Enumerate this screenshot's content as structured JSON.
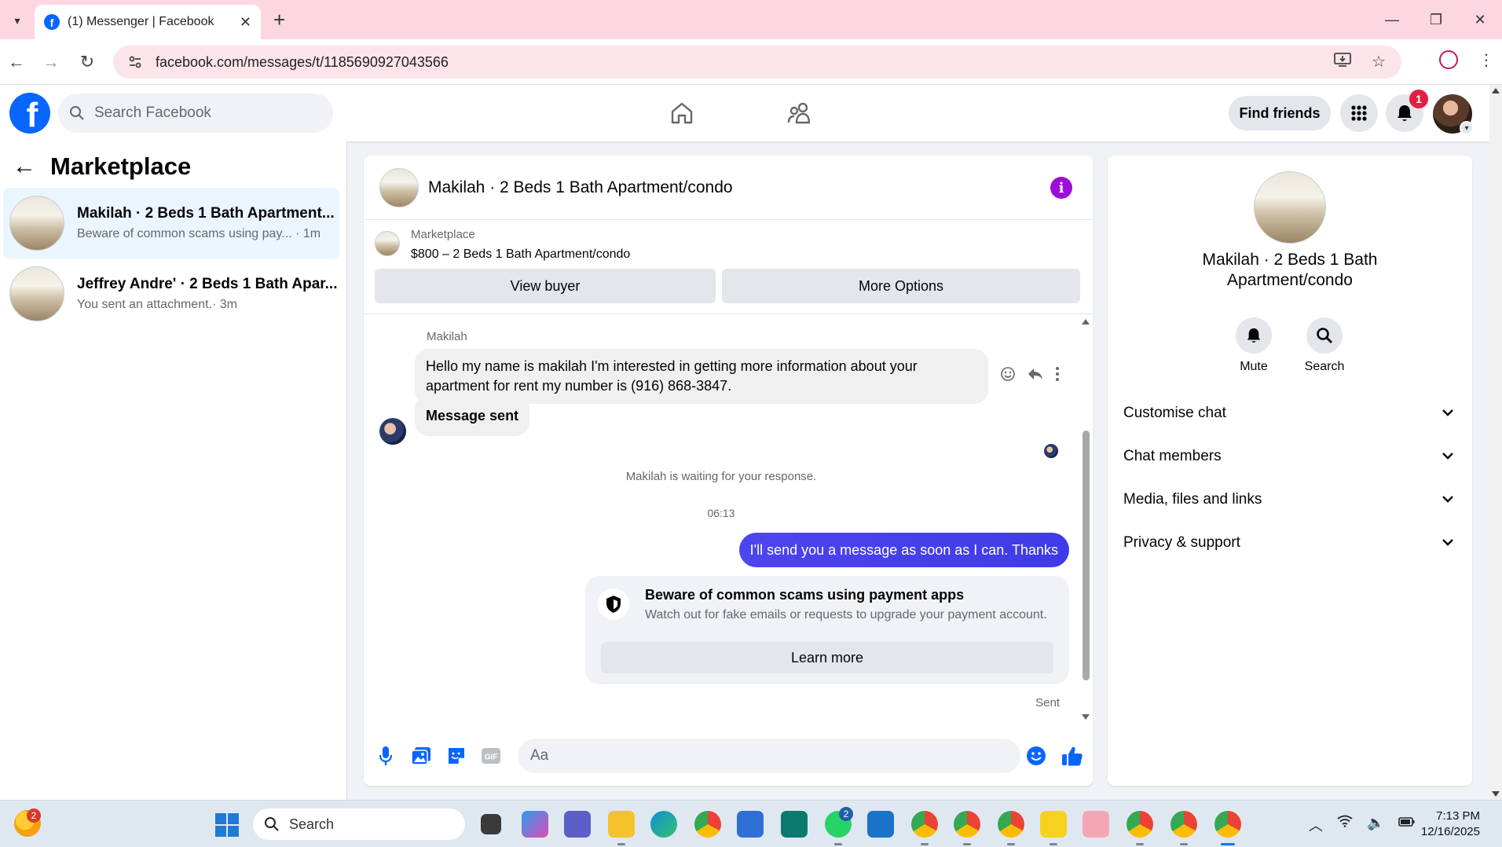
{
  "browser": {
    "tab_title": "(1) Messenger | Facebook",
    "url": "facebook.com/messages/t/1185690927043566"
  },
  "header": {
    "search_placeholder": "Search Facebook",
    "find_friends": "Find friends",
    "notification_count": "1"
  },
  "sidebar": {
    "title": "Marketplace",
    "conversations": [
      {
        "name": "Makilah · 2 Beds 1 Bath Apartment...",
        "preview": "Beware of common scams using pay...",
        "time": "· 1m",
        "active": true
      },
      {
        "name": "Jeffrey Andre' · 2 Beds 1 Bath Apar...",
        "preview": "You sent an attachment.",
        "time": "· 3m",
        "active": false
      }
    ]
  },
  "chat": {
    "title": "Makilah · 2 Beds 1 Bath Apartment/condo",
    "marketplace_label": "Marketplace",
    "listing": "$800 – 2 Beds 1 Bath Apartment/condo",
    "view_buyer": "View buyer",
    "more_options": "More Options",
    "sender_name": "Makilah",
    "incoming_message": "Hello my name is makilah I'm interested in getting more information about your apartment for rent my number is (916) 868-3847.",
    "incoming_message_2": "Message sent",
    "waiting_notice": "Makilah is waiting for your response.",
    "time_separator": "06:13",
    "outgoing_message": "I'll send you a message as soon as I can. Thanks",
    "scam_title": "Beware of common scams using payment apps",
    "scam_subtitle": "Watch out for fake emails or requests to upgrade your payment account.",
    "learn_more": "Learn more",
    "sent_status": "Sent",
    "composer_placeholder": "Aa"
  },
  "details": {
    "name": "Makilah · 2 Beds 1 Bath Apartment/condo",
    "mute_label": "Mute",
    "search_label": "Search",
    "sections": [
      "Customise chat",
      "Chat members",
      "Media, files and links",
      "Privacy & support"
    ]
  },
  "taskbar": {
    "weather_badge": "2",
    "search_placeholder": "Search",
    "whatsapp_badge": "2",
    "time": "7:13 PM",
    "date": "12/16/2025"
  },
  "colors": {
    "facebook_blue": "#0866ff",
    "outgoing_bubble": "#4d45ee",
    "info_purple": "#9b0fd8",
    "tab_strip_pink": "#fcd6e1"
  }
}
